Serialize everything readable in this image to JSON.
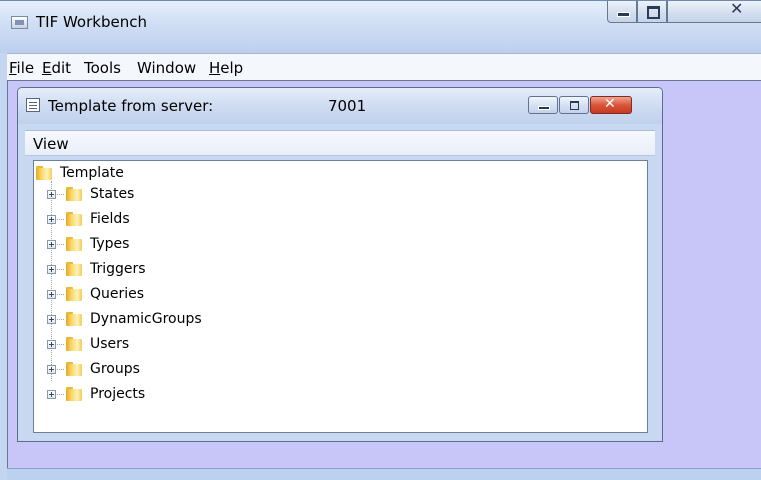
{
  "app": {
    "title": "TIF Workbench"
  },
  "menubar": {
    "items": [
      {
        "label": "File",
        "mnemonic": "F",
        "rest": "ile"
      },
      {
        "label": "Edit",
        "mnemonic": "E",
        "rest": "dit"
      },
      {
        "label": "Tools",
        "mnemonic": "",
        "rest": "Tools"
      },
      {
        "label": "Window",
        "mnemonic": "",
        "rest": "Window"
      },
      {
        "label": "Help",
        "mnemonic": "H",
        "rest": "elp"
      }
    ]
  },
  "child_window": {
    "title_prefix": "Template from server:",
    "title_suffix": "7001",
    "menu": {
      "view_label": "View"
    },
    "tree": {
      "root": "Template",
      "children": [
        "States",
        "Fields",
        "Types",
        "Triggers",
        "Queries",
        "DynamicGroups",
        "Users",
        "Groups",
        "Projects"
      ]
    }
  },
  "colors": {
    "mdi_background": "#c8c6f9",
    "close_button": "#d9563c"
  }
}
